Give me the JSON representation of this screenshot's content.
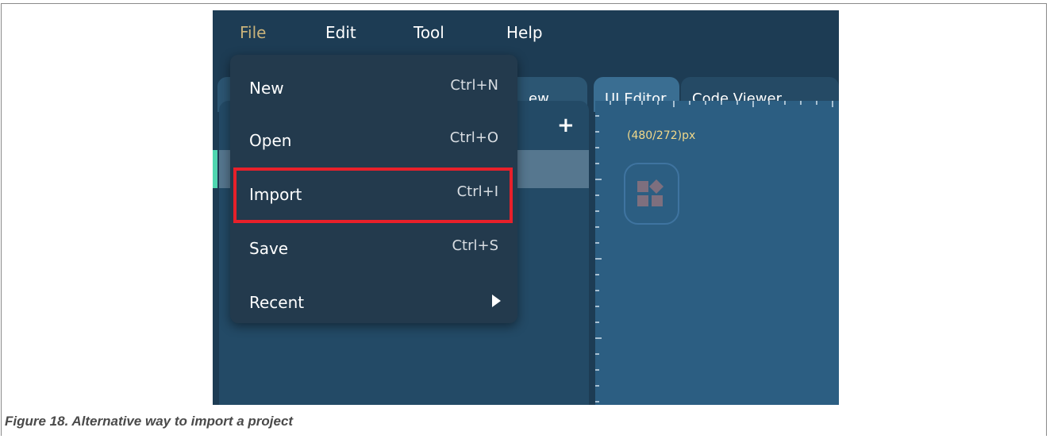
{
  "menubar": {
    "items": [
      "File",
      "Edit",
      "Tool",
      "Help"
    ]
  },
  "tabs": {
    "left_partial": "ew",
    "ui_editor": "UI Editor",
    "code_viewer": "Code Viewer"
  },
  "canvas": {
    "resolution": "(480/272)px"
  },
  "file_menu": {
    "items": [
      {
        "label": "New",
        "shortcut": "Ctrl+N"
      },
      {
        "label": "Open",
        "shortcut": "Ctrl+O"
      },
      {
        "label": "Import",
        "shortcut": "Ctrl+I"
      },
      {
        "label": "Save",
        "shortcut": "Ctrl+S"
      },
      {
        "label": "Recent",
        "shortcut": ""
      }
    ],
    "highlighted": "Import"
  },
  "caption": "Figure 18.  Alternative way to import a project",
  "colors": {
    "app_bg": "#1d3c54",
    "highlight": "#e8202a",
    "active_menu": "#c8b27a",
    "accent": "#4fd6b0"
  },
  "icons": [
    "plus-icon",
    "widgets-icon",
    "submenu-arrow-icon"
  ]
}
